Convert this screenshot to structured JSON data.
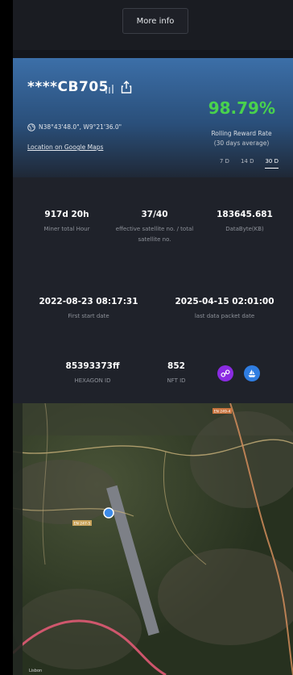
{
  "header": {
    "more_info_label": "More info"
  },
  "miner": {
    "name": "****CB705",
    "coordinates": "N38°43'48.0\", W9°21'36.0\"",
    "maps_link": "Location on Google Maps"
  },
  "reward": {
    "percent": "98.79%",
    "label": "Rolling Reward Rate",
    "sub": "(30 days average)",
    "periods": [
      "7 D",
      "14 D",
      "30 D"
    ],
    "active_period": "30 D"
  },
  "stats": {
    "total_hour": {
      "value": "917d 20h",
      "label": "Miner total Hour"
    },
    "satellite": {
      "value": "37/40",
      "label": "effective satellite no. / total satellite no."
    },
    "databyte": {
      "value": "183645.681",
      "label": "DataByte(KB)"
    },
    "first_start": {
      "value": "2022-08-23 08:17:31",
      "label": "First start date"
    },
    "last_packet": {
      "value": "2025-04-15 02:01:00",
      "label": "last data packet date"
    },
    "hexagon": {
      "value": "85393373ff",
      "label": "HEXAGON ID"
    },
    "nft": {
      "value": "852",
      "label": "NFT ID"
    }
  },
  "colors": {
    "accent_green": "#49d24d",
    "card_blue": "#3c6fa8",
    "link_icon_purple": "#8a2be2",
    "ship_icon_blue": "#2f7de1"
  },
  "map": {
    "road_labels": [
      "EN 249-4",
      "EN 247-5",
      "Lisbon"
    ]
  }
}
